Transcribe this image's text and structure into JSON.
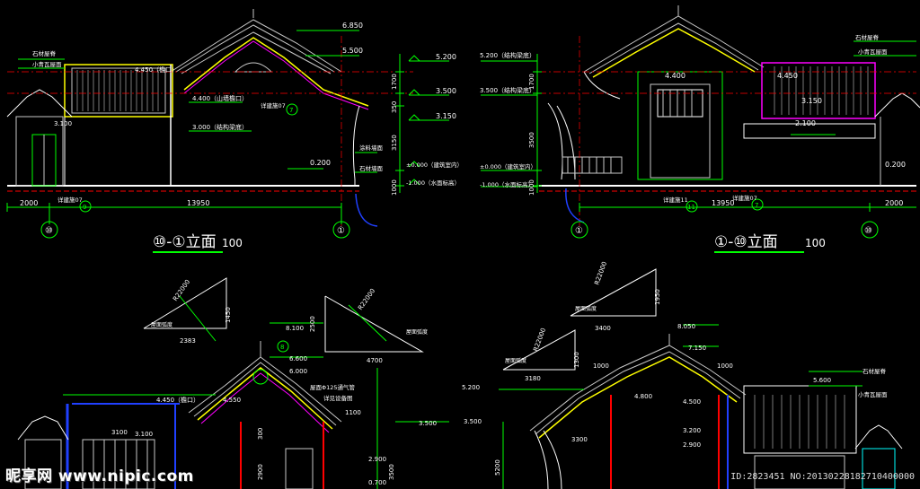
{
  "colors": {
    "ground": "#ffffff",
    "dim": "#00ff00",
    "red": "#ff0000",
    "yellow": "#ffff00",
    "cyan": "#00ffff",
    "magenta": "#ff00ff",
    "blue": "#2040ff",
    "roof": "#c8c8c8"
  },
  "left_elevation": {
    "title": "⑩-①立面",
    "scale": "100",
    "elev_labels": [
      "6.850",
      "5.500",
      "5.200",
      "3.500",
      "3.150",
      "0.200",
      "±0.000（建筑室内）",
      "-1.000（水面标高）"
    ],
    "notes": [
      "石材屋脊",
      "小青瓦屋面",
      "4.450（檐口）",
      "4.400（山墙檐口）",
      "3.000（结构梁底）",
      "3.100",
      "详建施07",
      "涂料墙面",
      "石材墙面",
      "详建施07"
    ],
    "dims": [
      "1700",
      "350",
      "3150",
      "1000",
      "2000",
      "13950"
    ],
    "axes": [
      "⑩",
      "①"
    ],
    "detail_marks": [
      "7",
      "9"
    ]
  },
  "right_elevation": {
    "title": "①-⑩立面",
    "scale": "100",
    "elev_labels": [
      "5.200（结构梁底）",
      "3.500（结构梁底）",
      "±0.000（建筑室内）",
      "-1.000（水面标高）",
      "4.400",
      "4.450",
      "3.150",
      "2.100",
      "0.200"
    ],
    "notes": [
      "石材屋脊",
      "小青瓦屋面",
      "详建施11",
      "详建施07"
    ],
    "dims": [
      "1700",
      "3500",
      "1000",
      "13950",
      "2000"
    ],
    "axes": [
      "①",
      "⑩"
    ],
    "detail_marks": [
      "11",
      "7"
    ]
  },
  "bottom_left": {
    "dims": [
      "2383",
      "1450",
      "R22000",
      "屋面弧度",
      "2500",
      "4700",
      "R22000",
      "屋面弧度",
      "3100"
    ],
    "elev_labels": [
      "8.100",
      "6.600",
      "6.000",
      "4.450（檐口）",
      "4.550",
      "3.500"
    ],
    "notes": [
      "屋面Φ125通气管",
      "详见设备图",
      "1100",
      "300",
      "2900",
      "2.900",
      "0.700",
      "3500",
      "3.100"
    ],
    "detail_marks": [
      "8"
    ]
  },
  "bottom_right": {
    "dims": [
      "R22000",
      "1950",
      "3400",
      "屋面弧度",
      "R22000",
      "3180",
      "1300",
      "屋面弧度",
      "1000",
      "1000",
      "3300",
      "5200"
    ],
    "elev_labels": [
      "8.050",
      "7.150",
      "5.600",
      "5.200",
      "4.800",
      "4.500",
      "3.500",
      "3.200",
      "2.900"
    ],
    "notes": [
      "石材屋脊",
      "小青瓦屋面"
    ]
  },
  "watermark": {
    "logo": "昵享网 www.nipic.com",
    "id": "ID:2823451 NO:20130228182710400000"
  }
}
